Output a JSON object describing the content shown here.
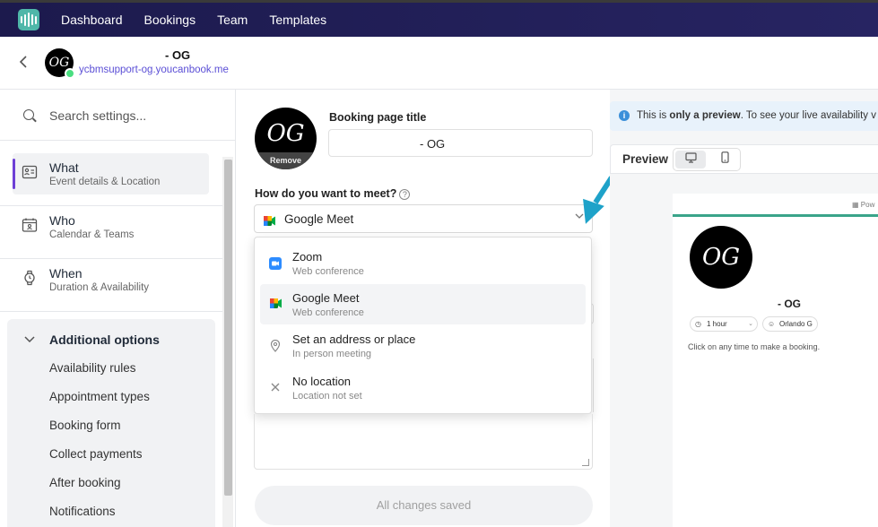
{
  "nav": {
    "items": [
      "Dashboard",
      "Bookings",
      "Team",
      "Templates"
    ]
  },
  "header": {
    "avatar_text": "OG",
    "title": "- OG",
    "url": "ycbmsupport-og.youcanbook.me"
  },
  "sidebar": {
    "search_placeholder": "Search settings...",
    "sections": [
      {
        "title": "What",
        "subtitle": "Event details & Location",
        "icon": "id-card-icon"
      },
      {
        "title": "Who",
        "subtitle": "Calendar & Teams",
        "icon": "calendar-person-icon"
      },
      {
        "title": "When",
        "subtitle": "Duration & Availability",
        "icon": "watch-icon"
      }
    ],
    "additional": {
      "title": "Additional options",
      "items": [
        "Availability rules",
        "Appointment types",
        "Booking form",
        "Collect payments",
        "After booking",
        "Notifications"
      ]
    }
  },
  "main": {
    "avatar_text": "OG",
    "avatar_remove": "Remove",
    "title_label": "Booking page title",
    "title_value": "- OG",
    "meet_label": "How do you want to meet?",
    "meet_selected": "Google Meet",
    "options": [
      {
        "title": "Zoom",
        "subtitle": "Web conference",
        "icon": "zoom-icon"
      },
      {
        "title": "Google Meet",
        "subtitle": "Web conference",
        "icon": "google-meet-icon"
      },
      {
        "title": "Set an address or place",
        "subtitle": "In person meeting",
        "icon": "location-pin-icon"
      },
      {
        "title": "No location",
        "subtitle": "Location not set",
        "icon": "close-icon"
      }
    ],
    "save_status": "All changes saved"
  },
  "preview": {
    "notice_prefix": "This is ",
    "notice_bold": "only a preview",
    "notice_suffix": ". To see your live availability v",
    "label": "Preview",
    "card": {
      "powered": "Pow",
      "avatar_text": "OG",
      "name": "- OG",
      "duration": "1 hour",
      "person": "Orlando G",
      "message": "Click on any time to make a booking."
    }
  },
  "colors": {
    "nav_bg": "#1c1a4d",
    "accent": "#6d3fd6",
    "logo": "#4fb7a9",
    "arrow": "#1ea2c9",
    "card_strip": "#3aa48a"
  }
}
